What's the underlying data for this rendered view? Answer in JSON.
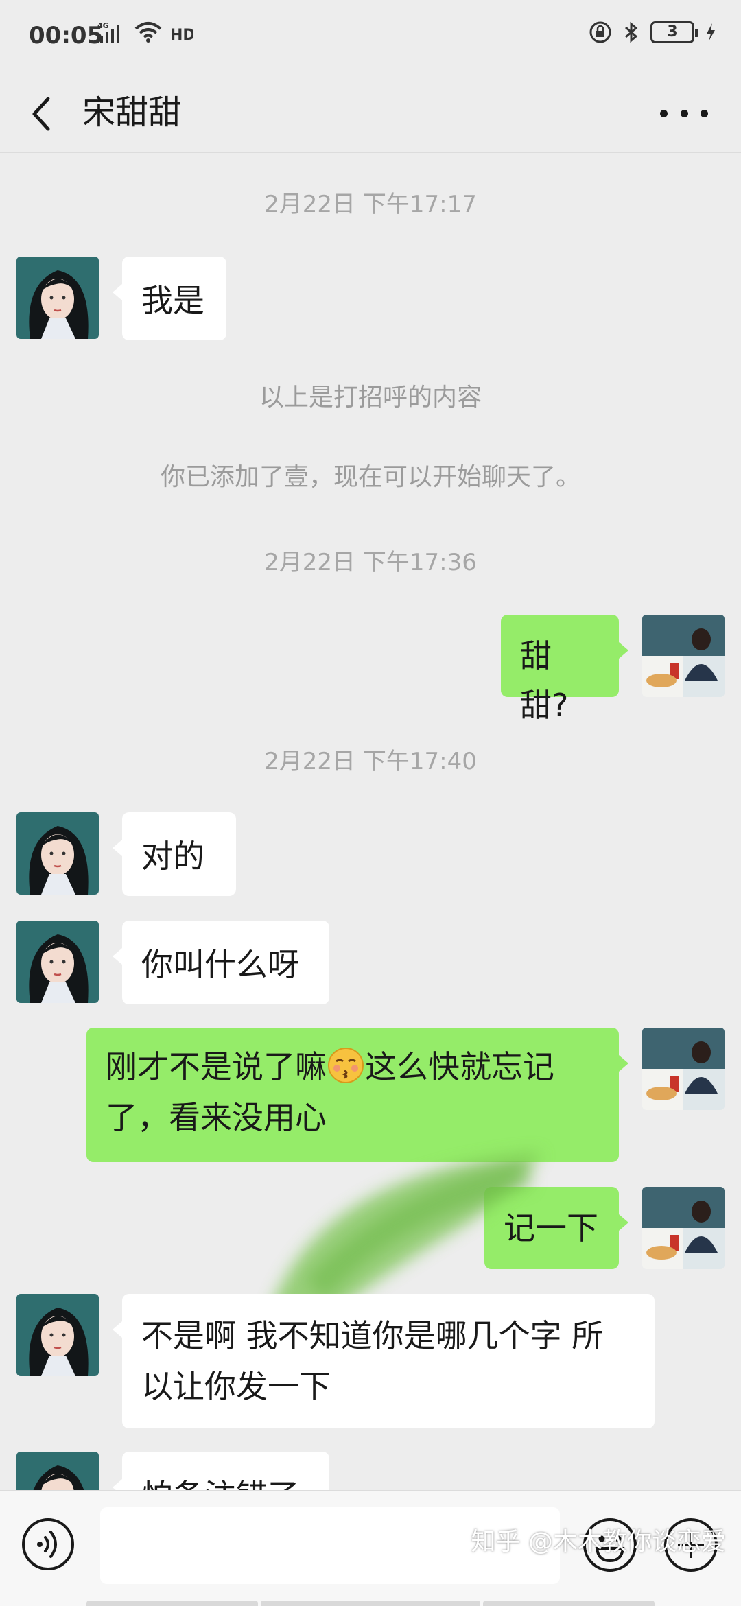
{
  "status_bar": {
    "time": "00:05",
    "network": "4G",
    "hd": "HD",
    "battery": "3"
  },
  "header": {
    "title": "宋甜甜"
  },
  "timestamps": [
    "2月22日 下午17:17",
    "2月22日 下午17:36",
    "2月22日 下午17:40"
  ],
  "system_messages": [
    "以上是打招呼的内容",
    "你已添加了壹，现在可以开始聊天了。"
  ],
  "messages": [
    {
      "from": "contact",
      "text": "我是"
    },
    {
      "from": "me",
      "text": "甜甜?"
    },
    {
      "from": "contact",
      "text": "对的"
    },
    {
      "from": "contact",
      "text": "你叫什么呀"
    },
    {
      "from": "me",
      "text_line1": "刚才不是说了嘛",
      "text_line1b": "这么快就忘记",
      "text_line2": "了，看来没用心",
      "emoji": "kissing-face-emoji"
    },
    {
      "from": "me",
      "text": "记一下"
    },
    {
      "from": "contact",
      "text_line1": "不是啊 我不知道你是哪几个字 所",
      "text_line2": "以让你发一下"
    },
    {
      "from": "contact",
      "text": "怕备注错了"
    }
  ],
  "input_bar": {
    "placeholder": ""
  },
  "watermark": "知乎 @木木教你谈恋爱",
  "colors": {
    "background": "#ededed",
    "outgoing_bubble": "#95ec69",
    "incoming_bubble": "#ffffff"
  }
}
